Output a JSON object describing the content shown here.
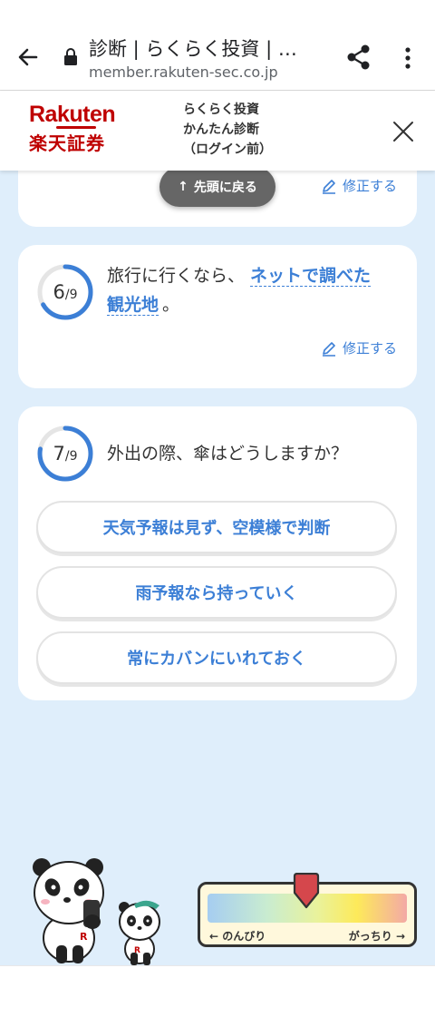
{
  "browser": {
    "title": "診断 | らくらく投資 | …",
    "url": "member.rakuten-sec.co.jp"
  },
  "header": {
    "logo_en": "Rakuten",
    "logo_jp": "楽天証券",
    "lines": [
      "らくらく投資",
      "かんたん診断",
      "（ログイン前）"
    ]
  },
  "card1": {
    "scroll_top_label": "先頭に戻る",
    "edit_label": "修正する"
  },
  "card2": {
    "progress_num": "6",
    "progress_den": "/9",
    "progress_fraction": 0.667,
    "question_prefix": "旅行に行くなら、",
    "answer_part1": "ネットで調べた",
    "answer_part2": "観光地",
    "question_suffix": "。",
    "edit_label": "修正する"
  },
  "card3": {
    "progress_num": "7",
    "progress_den": "/9",
    "progress_fraction": 0.778,
    "question": "外出の際、傘はどうしますか？",
    "options": [
      "天気予報は見ず、空模様で判断",
      "雨予報なら持っていく",
      "常にカバンにいれておく"
    ]
  },
  "meter": {
    "left_label": "← のんびり",
    "right_label": "がっちり →",
    "level": 0.5
  },
  "colors": {
    "accent": "#3c7fd6",
    "brand": "#bf0000",
    "background": "#dfeefb"
  }
}
